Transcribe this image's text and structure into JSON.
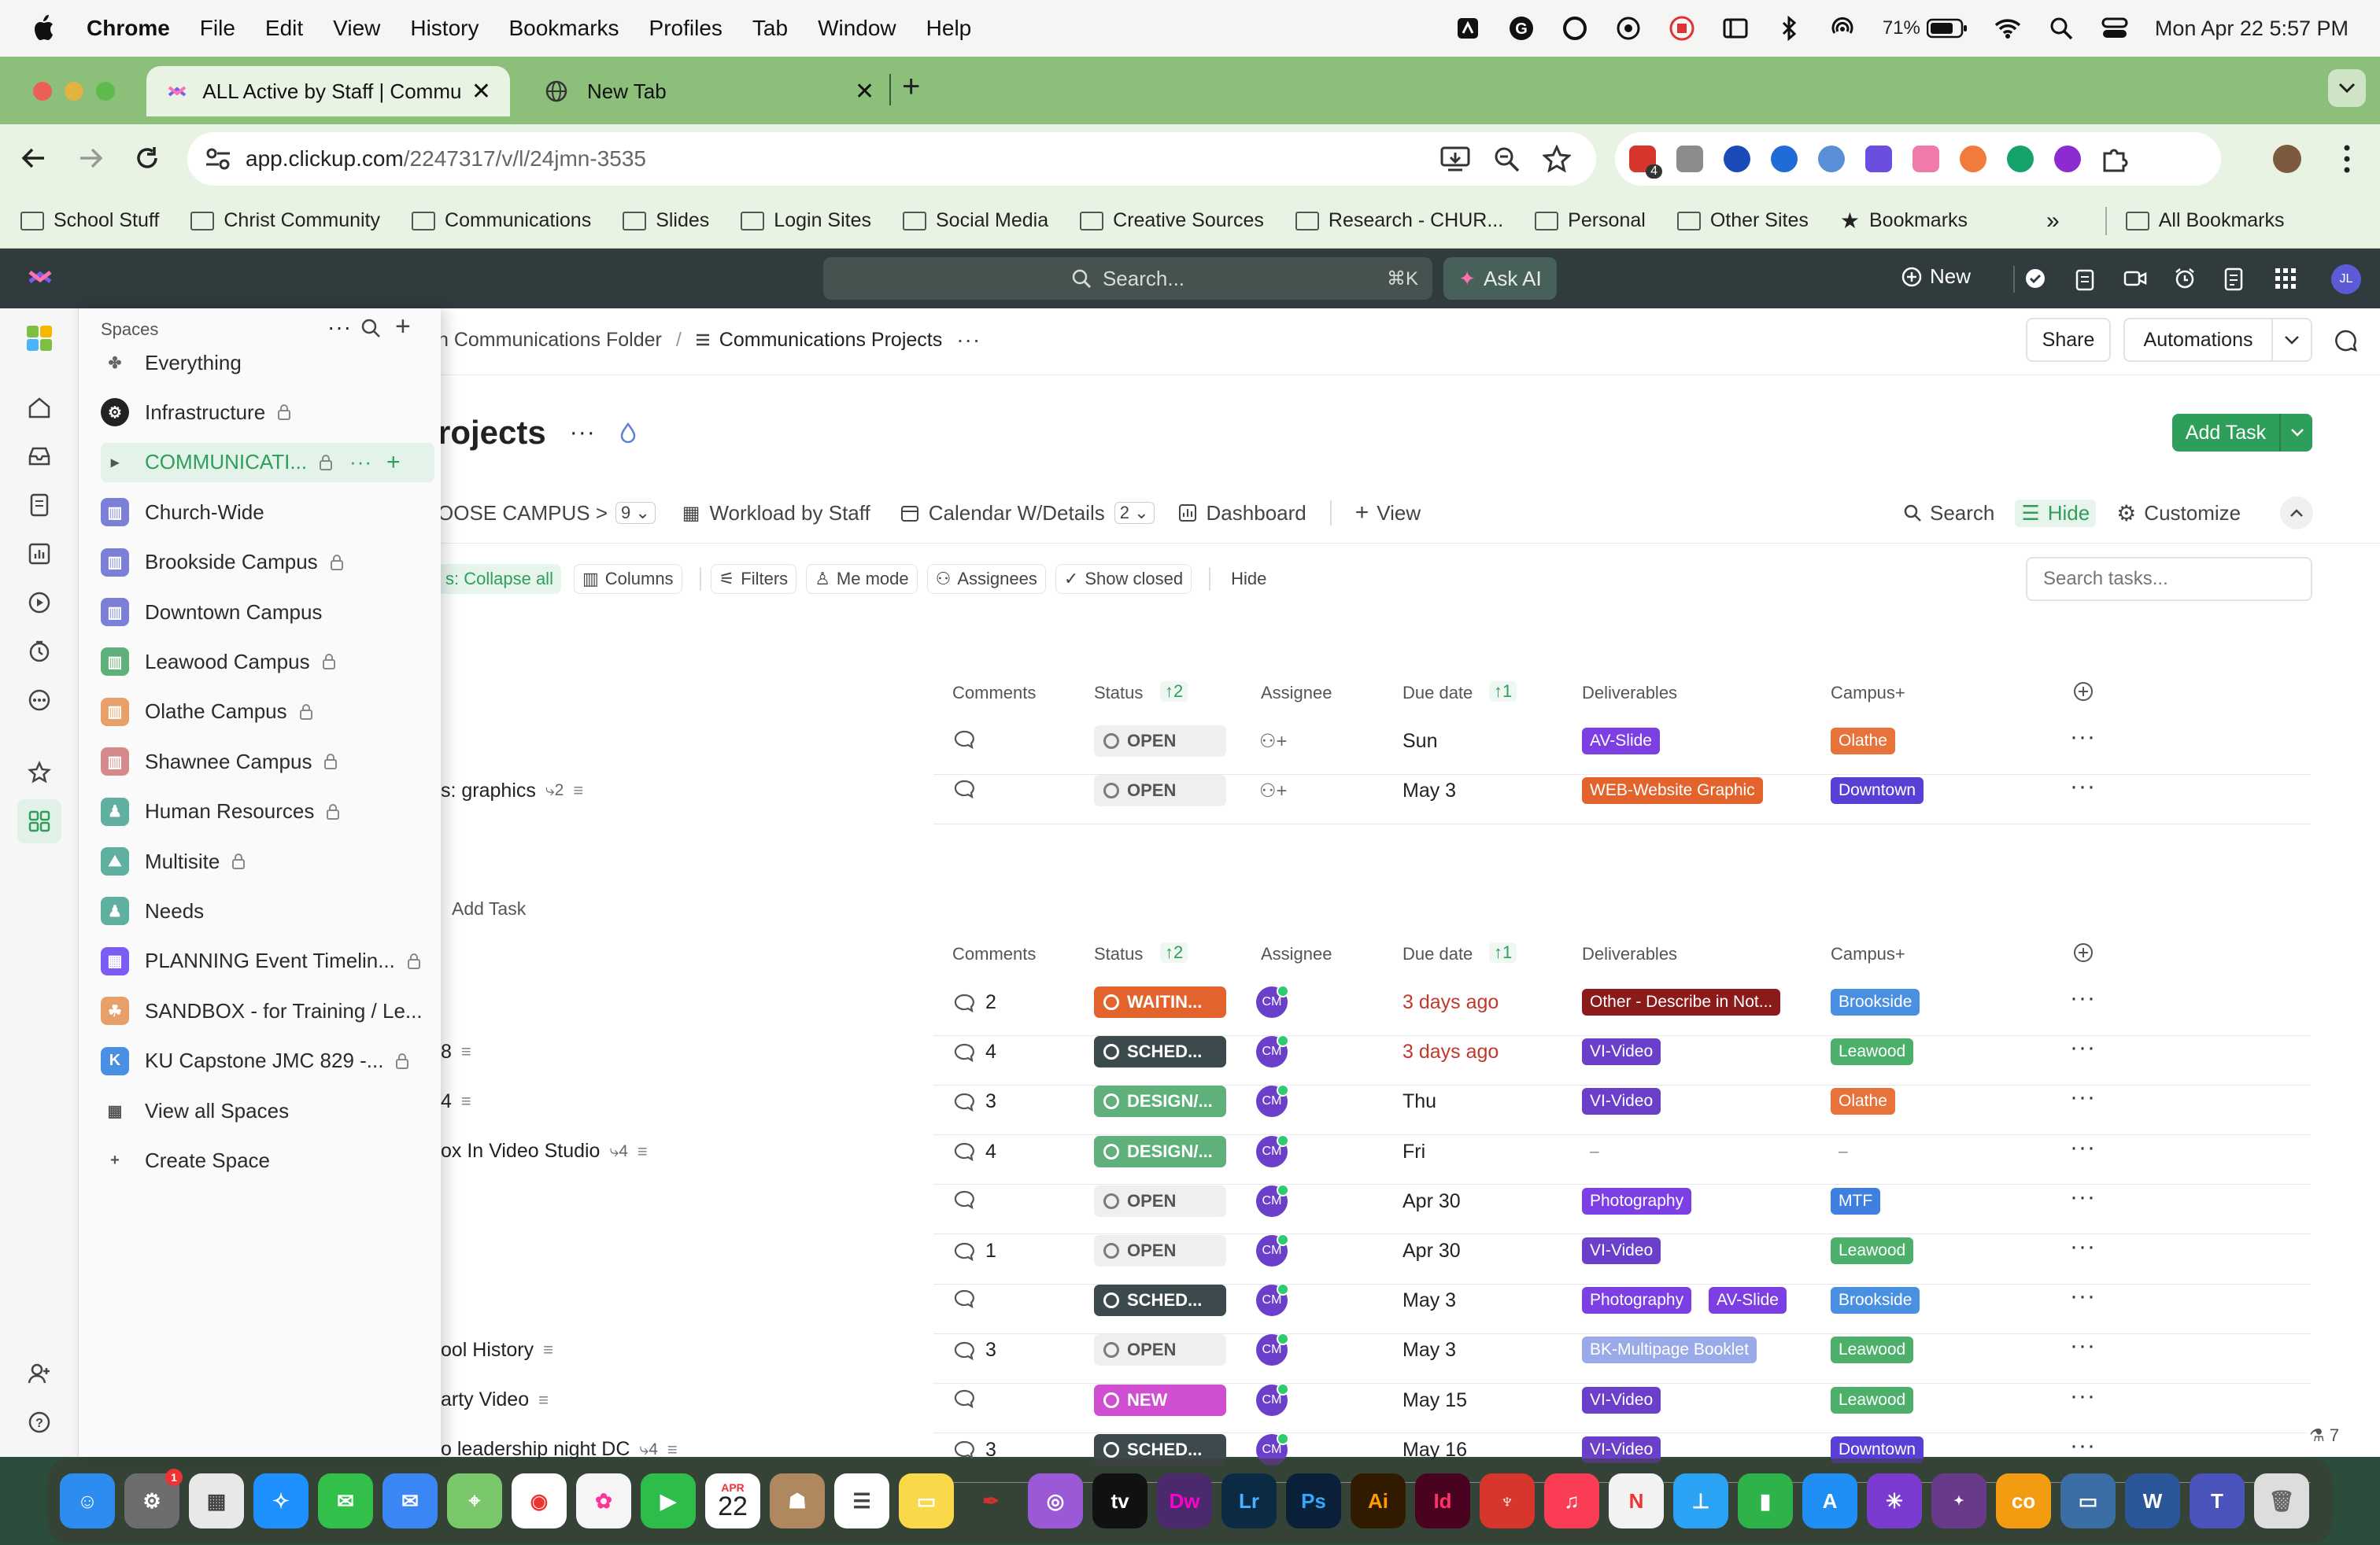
{
  "menubar": {
    "app": "Chrome",
    "items": [
      "File",
      "Edit",
      "View",
      "History",
      "Bookmarks",
      "Profiles",
      "Tab",
      "Window",
      "Help"
    ],
    "battery": "71%",
    "datetime": "Mon Apr 22  5:57 PM"
  },
  "tabs": [
    {
      "title": "ALL Active by Staff | Commu"
    },
    {
      "title": "New Tab"
    }
  ],
  "omnibox": {
    "domain": "app.clickup.com",
    "path": "/2247317/v/l/24jmn-3535"
  },
  "ext_badge": "4",
  "bookmarks": [
    "School Stuff",
    "Christ Community",
    "Communications",
    "Slides",
    "Login Sites",
    "Social Media",
    "Creative Sources",
    "Research - CHUR...",
    "Personal",
    "Other Sites",
    "Bookmarks",
    "All Bookmarks"
  ],
  "topbar": {
    "search": "Search...",
    "shortcut": "⌘K",
    "askai": "Ask AI",
    "new": "New",
    "avatar": "JL"
  },
  "breadcrumb": {
    "folder": "n Communications Folder",
    "sep": "/",
    "list": "Communications Projects"
  },
  "header": {
    "share": "Share",
    "automations": "Automations",
    "title": "rojects",
    "add_task": "Add Task"
  },
  "views": {
    "campus": "OOSE CAMPUS >",
    "campus_count": "9",
    "workload": "Workload by Staff",
    "calendar": "Calendar W/Details",
    "calendar_count": "2",
    "dashboard": "Dashboard",
    "view": "View",
    "search": "Search",
    "hide": "Hide",
    "customize": "Customize"
  },
  "filters": {
    "collapse": "s: Collapse all",
    "columns": "Columns",
    "filters": "Filters",
    "me_mode": "Me mode",
    "assignees": "Assignees",
    "show_closed": "Show closed",
    "hide": "Hide",
    "search_placeholder": "Search tasks..."
  },
  "columns": {
    "comments": "Comments",
    "status": "Status",
    "status_sort": "2",
    "assignee": "Assignee",
    "due": "Due date",
    "due_sort": "1",
    "deliverables": "Deliverables",
    "campus": "Campus+"
  },
  "group1": [
    {
      "name": "",
      "status": "OPEN",
      "due": "Sun",
      "deliv": [
        "AV-Slide"
      ],
      "campus": "Olathe"
    },
    {
      "name": "s: graphics",
      "subs": "2",
      "status": "OPEN",
      "due": "May 3",
      "deliv": [
        "WEB-Website Graphic"
      ],
      "campus": "Downtown"
    }
  ],
  "add_task": "Add Task",
  "group2": [
    {
      "name": "",
      "comments": "2",
      "status": "WAITIN...",
      "due": "3 days ago",
      "deliv": [
        "Other - Describe in Not..."
      ],
      "campus": "Brookside"
    },
    {
      "name": "8",
      "comments": "4",
      "status": "SCHED...",
      "due": "3 days ago",
      "deliv": [
        "VI-Video"
      ],
      "campus": "Leawood"
    },
    {
      "name": "4",
      "comments": "3",
      "status": "DESIGN/...",
      "due": "Thu",
      "deliv": [
        "VI-Video"
      ],
      "campus": "Olathe"
    },
    {
      "name": "ox In Video Studio",
      "subs": "4",
      "comments": "4",
      "status": "DESIGN/...",
      "due": "Fri",
      "deliv": [
        "–"
      ],
      "campus": "–"
    },
    {
      "name": "",
      "comments": "",
      "status": "OPEN",
      "due": "Apr 30",
      "deliv": [
        "Photography"
      ],
      "campus": "MTF"
    },
    {
      "name": "",
      "comments": "1",
      "status": "OPEN",
      "due": "Apr 30",
      "deliv": [
        "VI-Video"
      ],
      "campus": "Leawood"
    },
    {
      "name": "",
      "comments": "",
      "status": "SCHED...",
      "due": "May 3",
      "deliv": [
        "Photography",
        "AV-Slide"
      ],
      "campus": "Brookside"
    },
    {
      "name": "ool History",
      "comments": "3",
      "status": "OPEN",
      "due": "May 3",
      "deliv": [
        "BK-Multipage Booklet"
      ],
      "campus": "Leawood"
    },
    {
      "name": "arty Video",
      "comments": "",
      "status": "NEW",
      "due": "May 15",
      "deliv": [
        "VI-Video"
      ],
      "campus": "Leawood"
    },
    {
      "name": "o leadership night DC",
      "subs": "4",
      "comments": "3",
      "status": "SCHED...",
      "due": "May 16",
      "deliv": [
        "VI-Video"
      ],
      "campus": "Downtown"
    }
  ],
  "assignee_initials": "CM",
  "spaces": {
    "header": "Spaces",
    "items": [
      "Everything",
      "Infrastructure",
      "COMMUNICATI...",
      "Church-Wide",
      "Brookside Campus",
      "Downtown Campus",
      "Leawood Campus",
      "Olathe Campus",
      "Shawnee Campus",
      "Human Resources",
      "Multisite",
      "Needs",
      "PLANNING Event Timelin...",
      "SANDBOX - for Training / Le...",
      "KU Capstone JMC 829 -...",
      "View all Spaces",
      "Create Space"
    ],
    "ku_letter": "K"
  },
  "corner_count": "7",
  "dock_calendar": {
    "month": "APR",
    "day": "22"
  },
  "colors": {
    "accent": "#2e9e5b",
    "overdue": "#c0392b",
    "open": "#7b7b7b",
    "waiting": "#e2632b",
    "sched": "#3d4a4d",
    "design": "#5fb07a",
    "new": "#d04fd0"
  }
}
